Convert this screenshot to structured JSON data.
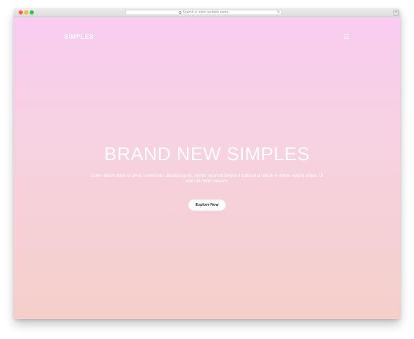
{
  "browser": {
    "url_placeholder": "Search or enter website name",
    "reload_icon": "reload-icon",
    "tab_icon": "plus-icon"
  },
  "site": {
    "brand": "SIMPLES",
    "menu_icon": "hamburger-icon"
  },
  "hero": {
    "title": "BRAND NEW SIMPLES",
    "text": "Lorem ipsum dolor sit amet, consectetur adipisicing elit, sed do eiusmod tempor incididunt ut labore et dolore magna aliqua. Ut enim ad minim veniam.",
    "cta_label": "Explore Now"
  },
  "colors": {
    "gradient_top": "#f9ccf1",
    "gradient_bottom": "#f5cfc9",
    "text": "#ffffff",
    "button_bg": "#ffffff"
  }
}
